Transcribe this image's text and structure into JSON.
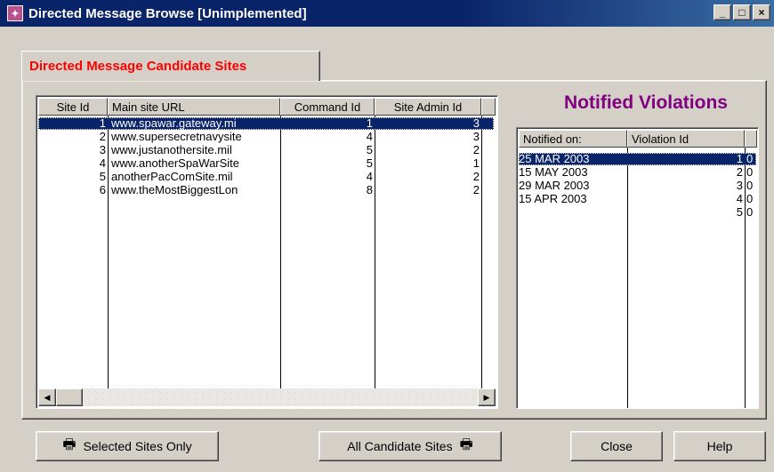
{
  "window": {
    "title": "Directed Message Browse [Unimplemented]",
    "app_icon": "app-icon",
    "controls": {
      "minimize": "_",
      "maximize": "□",
      "close": "×"
    }
  },
  "tab": {
    "label": "Directed Message Candidate Sites",
    "color": "#ff0000"
  },
  "sites_table": {
    "columns": [
      "Site Id",
      "Main site URL",
      "Command Id",
      "Site Admin Id"
    ],
    "rows": [
      {
        "site_id": "1",
        "url": "www.spawar.gateway.mi",
        "command_id": "1",
        "admin_id": "3",
        "selected": true
      },
      {
        "site_id": "2",
        "url": "www.supersecretnavysite",
        "command_id": "4",
        "admin_id": "3",
        "selected": false
      },
      {
        "site_id": "3",
        "url": "www.justanothersite.mil",
        "command_id": "5",
        "admin_id": "2",
        "selected": false
      },
      {
        "site_id": "4",
        "url": "www.anotherSpaWarSite",
        "command_id": "5",
        "admin_id": "1",
        "selected": false
      },
      {
        "site_id": "5",
        "url": "anotherPacComSite.mil",
        "command_id": "4",
        "admin_id": "2",
        "selected": false
      },
      {
        "site_id": "6",
        "url": "www.theMostBiggestLon",
        "command_id": "8",
        "admin_id": "2",
        "selected": false
      }
    ]
  },
  "violations": {
    "title": "Notified Violations",
    "title_color": "#800080",
    "columns": [
      "Notified on:",
      "Violation Id"
    ],
    "rows": [
      {
        "notified_on": "25 MAR 2003",
        "violation_id": "1",
        "extra": "0",
        "selected": true
      },
      {
        "notified_on": "15 MAY 2003",
        "violation_id": "2",
        "extra": "0",
        "selected": false
      },
      {
        "notified_on": "29 MAR 2003",
        "violation_id": "3",
        "extra": "0",
        "selected": false
      },
      {
        "notified_on": "15 APR 2003",
        "violation_id": "4",
        "extra": "0",
        "selected": false
      },
      {
        "notified_on": "",
        "violation_id": "5",
        "extra": "0",
        "selected": false
      }
    ]
  },
  "buttons": {
    "selected_sites": "Selected Sites Only",
    "all_sites": "All Candidate Sites",
    "close": "Close",
    "help": "Help"
  },
  "colors": {
    "selection": "#0a246a",
    "titlebar": "#0a246a",
    "face": "#d4d0c8"
  }
}
